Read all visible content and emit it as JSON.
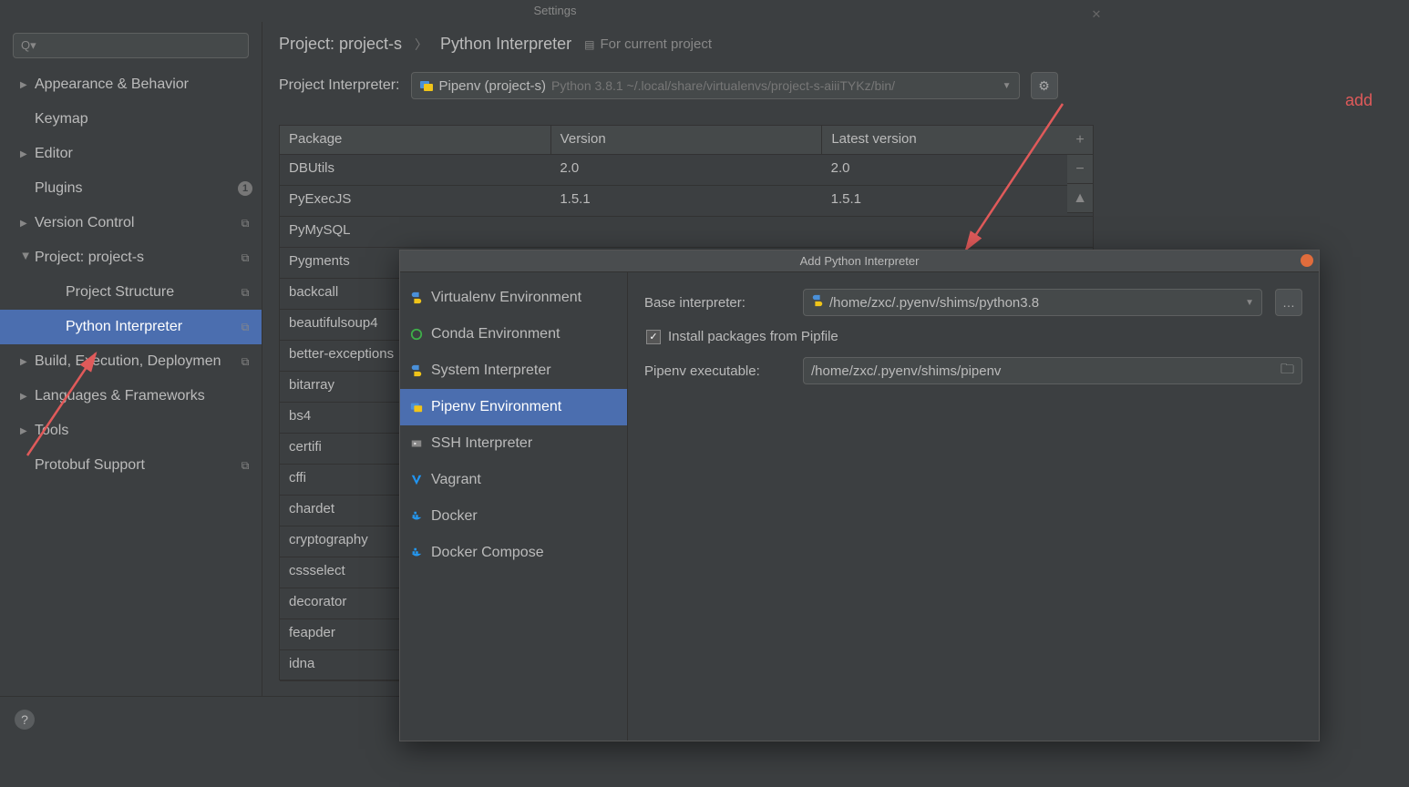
{
  "settings_title": "Settings",
  "search_placeholder": "",
  "sidebar": {
    "items": [
      {
        "label": "Appearance & Behavior",
        "expandable": true,
        "expanded": false
      },
      {
        "label": "Keymap",
        "expandable": false
      },
      {
        "label": "Editor",
        "expandable": true,
        "expanded": false
      },
      {
        "label": "Plugins",
        "expandable": false,
        "badge": "1"
      },
      {
        "label": "Version Control",
        "expandable": true,
        "expanded": false,
        "icon": "copy"
      },
      {
        "label": "Project: project-s",
        "expandable": true,
        "expanded": true,
        "icon": "copy"
      },
      {
        "label": "Project Structure",
        "indent": 2,
        "icon": "copy"
      },
      {
        "label": "Python Interpreter",
        "indent": 2,
        "selected": true,
        "icon": "copy"
      },
      {
        "label": "Build, Execution, Deploymen",
        "expandable": true,
        "expanded": false,
        "icon": "copy"
      },
      {
        "label": "Languages & Frameworks",
        "expandable": true,
        "expanded": false
      },
      {
        "label": "Tools",
        "expandable": true,
        "expanded": false
      },
      {
        "label": "Protobuf Support",
        "expandable": false,
        "icon": "copy"
      }
    ]
  },
  "breadcrumb": {
    "project": "Project: project-s",
    "page": "Python Interpreter",
    "for_project": "For current project"
  },
  "interpreter": {
    "label": "Project Interpreter:",
    "name": "Pipenv (project-s)",
    "path": "Python 3.8.1 ~/.local/share/virtualenvs/project-s-aiiiTYKz/bin/"
  },
  "packages": {
    "headers": [
      "Package",
      "Version",
      "Latest version"
    ],
    "rows": [
      {
        "name": "DBUtils",
        "version": "2.0",
        "latest": "2.0"
      },
      {
        "name": "PyExecJS",
        "version": "1.5.1",
        "latest": "1.5.1"
      },
      {
        "name": "PyMySQL",
        "version": "",
        "latest": ""
      },
      {
        "name": "Pygments",
        "version": "",
        "latest": ""
      },
      {
        "name": "backcall",
        "version": "",
        "latest": ""
      },
      {
        "name": "beautifulsoup4",
        "version": "",
        "latest": ""
      },
      {
        "name": "better-exceptions",
        "version": "",
        "latest": ""
      },
      {
        "name": "bitarray",
        "version": "",
        "latest": ""
      },
      {
        "name": "bs4",
        "version": "",
        "latest": ""
      },
      {
        "name": "certifi",
        "version": "",
        "latest": ""
      },
      {
        "name": "cffi",
        "version": "",
        "latest": ""
      },
      {
        "name": "chardet",
        "version": "",
        "latest": ""
      },
      {
        "name": "cryptography",
        "version": "",
        "latest": ""
      },
      {
        "name": "cssselect",
        "version": "",
        "latest": ""
      },
      {
        "name": "decorator",
        "version": "",
        "latest": ""
      },
      {
        "name": "feapder",
        "version": "",
        "latest": ""
      },
      {
        "name": "idna",
        "version": "",
        "latest": ""
      }
    ]
  },
  "annotation": {
    "add": "add"
  },
  "dialog": {
    "title": "Add Python Interpreter",
    "envs": [
      {
        "label": "Virtualenv Environment",
        "icon": "python"
      },
      {
        "label": "Conda Environment",
        "icon": "conda"
      },
      {
        "label": "System Interpreter",
        "icon": "python"
      },
      {
        "label": "Pipenv Environment",
        "icon": "pipenv",
        "selected": true
      },
      {
        "label": "SSH Interpreter",
        "icon": "ssh"
      },
      {
        "label": "Vagrant",
        "icon": "vagrant"
      },
      {
        "label": "Docker",
        "icon": "docker"
      },
      {
        "label": "Docker Compose",
        "icon": "docker"
      }
    ],
    "form": {
      "base_label": "Base interpreter:",
      "base_value": "/home/zxc/.pyenv/shims/python3.8",
      "install_pkgs": "Install packages from Pipfile",
      "pipenv_label": "Pipenv executable:",
      "pipenv_value": "/home/zxc/.pyenv/shims/pipenv"
    }
  }
}
